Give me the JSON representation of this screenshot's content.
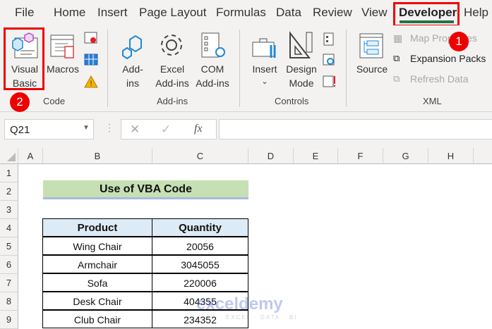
{
  "menu": {
    "items": [
      "File",
      "Home",
      "Insert",
      "Page Layout",
      "Formulas",
      "Data",
      "Review",
      "View",
      "Developer",
      "Help"
    ],
    "active": "Developer"
  },
  "ribbon": {
    "code": {
      "visual_basic": [
        "Visual",
        "Basic"
      ],
      "macros": "Macros",
      "group": "Code"
    },
    "addins": {
      "addins": [
        "Add-",
        "ins"
      ],
      "excel_addins": [
        "Excel",
        "Add-ins"
      ],
      "com_addins": [
        "COM",
        "Add-ins"
      ],
      "group": "Add-ins"
    },
    "controls": {
      "insert": "Insert",
      "design_mode": [
        "Design",
        "Mode"
      ],
      "group": "Controls"
    },
    "xml": {
      "source": "Source",
      "map_properties": "Map Properties",
      "expansion_packs": "Expansion Packs",
      "refresh_data": "Refresh Data",
      "group": "XML"
    }
  },
  "badges": [
    "1",
    "2"
  ],
  "formula_bar": {
    "name_box": "Q21",
    "cancel": "✕",
    "enter": "✓",
    "fx": "fx",
    "value": ""
  },
  "columns": [
    "A",
    "B",
    "C",
    "D",
    "E",
    "F",
    "G",
    "H"
  ],
  "rows": [
    "1",
    "2",
    "3",
    "4",
    "5",
    "6",
    "7",
    "8",
    "9"
  ],
  "sheet": {
    "title": "Use of VBA Code",
    "headers": [
      "Product",
      "Quantity"
    ],
    "data": [
      [
        "Wing Chair",
        "20056"
      ],
      [
        "Armchair",
        "3045055"
      ],
      [
        "Sofa",
        "220006"
      ],
      [
        "Desk Chair",
        "404355"
      ],
      [
        "Club Chair",
        "234352"
      ]
    ]
  },
  "watermark": {
    "name": "exceldemy",
    "tagline": "EXCEL · DATA · BI"
  },
  "colors": {
    "accent": "#217346",
    "highlight": "#e00000",
    "title_fill": "#c6e0b4",
    "header_fill": "#ddebf7"
  }
}
